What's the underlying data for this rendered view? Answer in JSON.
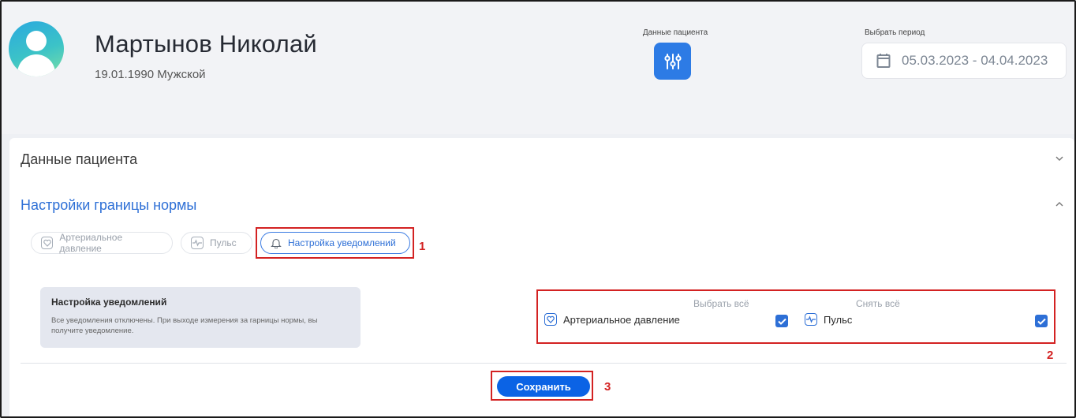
{
  "patient": {
    "name": "Мартынов Николай",
    "meta": "19.01.1990 Мужской"
  },
  "header": {
    "patient_data_caption": "Данные пациента",
    "period_caption": "Выбрать период",
    "period_value": "05.03.2023 - 04.04.2023"
  },
  "sections": {
    "patient_data_title": "Данные пациента",
    "norm_settings_title": "Настройки границы нормы"
  },
  "tabs": [
    {
      "label": "Артериальное давление",
      "icon": "heart-pressure-icon",
      "active": false
    },
    {
      "label": "Пульс",
      "icon": "pulse-icon",
      "active": false
    },
    {
      "label": "Настройка уведомлений",
      "icon": "bell-icon",
      "active": true
    }
  ],
  "notifications": {
    "title": "Настройка уведомлений",
    "description": "Все уведомления отключены. При выходе измерения за гарницы нормы, вы получите уведомление.",
    "select_all": "Выбрать всё",
    "unselect_all": "Снять всё",
    "items": [
      {
        "label": "Артериальное давление",
        "icon": "heart-pressure-icon",
        "checked": true
      },
      {
        "label": "Пульс",
        "icon": "pulse-icon",
        "checked": true
      }
    ]
  },
  "actions": {
    "save_label": "Сохранить"
  },
  "annotations": [
    "1",
    "2",
    "3"
  ],
  "colors": {
    "accent": "#2d6fd6",
    "save_button": "#0b63e5",
    "annotation": "#d32222"
  }
}
